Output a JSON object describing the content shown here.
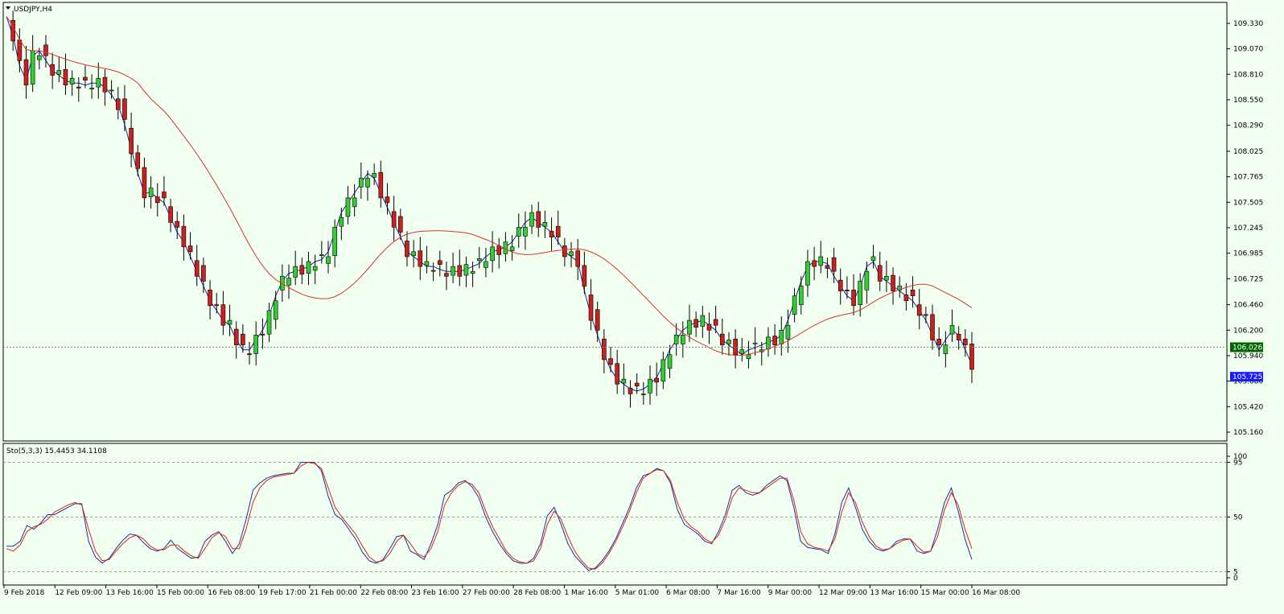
{
  "symbol_label": "USDJPY,H4",
  "indicator_label": "Sto(5,3,3) 15.4453 34.1108",
  "colors": {
    "background": "#f0fff0",
    "bull": "#32cd32",
    "bear": "#cc2020",
    "wick": "#000000",
    "ma_fast": "#2020a0",
    "ma_slow": "#e03030",
    "k_line": "#2030a0",
    "d_line": "#e02020",
    "bid_tag": "#006400",
    "ask_tag": "#1a1aff"
  },
  "chart_data": [
    {
      "type": "candlestick",
      "title": "USDJPY,H4",
      "ylim": [
        105.16,
        109.46
      ],
      "y_ticks": [
        "109.330",
        "109.070",
        "108.810",
        "108.550",
        "108.290",
        "108.025",
        "107.765",
        "107.505",
        "107.245",
        "106.985",
        "106.725",
        "106.460",
        "106.200",
        "105.940",
        "105.680",
        "105.420",
        "105.160"
      ],
      "price_tags": [
        {
          "label": "106.026",
          "value": 106.026,
          "kind": "bid"
        },
        {
          "label": "105.725",
          "value": 105.725,
          "kind": "ask"
        }
      ],
      "x_labels": [
        "9 Feb 2018",
        "12 Feb 09:00",
        "13 Feb 16:00",
        "15 Feb 00:00",
        "16 Feb 08:00",
        "19 Feb 17:00",
        "21 Feb 00:00",
        "22 Feb 08:00",
        "23 Feb 16:00",
        "27 Feb 00:00",
        "28 Feb 08:00",
        "1 Mar 16:00",
        "5 Mar 01:00",
        "6 Mar 08:00",
        "7 Mar 16:00",
        "9 Mar 00:00",
        "12 Mar 09:00",
        "13 Mar 16:00",
        "15 Mar 00:00",
        "16 Mar 08:00"
      ],
      "series_ma_fast": [
        109.4,
        109.2,
        108.9,
        108.75,
        109.0,
        109.05,
        108.95,
        108.85,
        108.8,
        108.75,
        108.72,
        108.72,
        108.7,
        108.72,
        108.72,
        108.68,
        108.6,
        108.5,
        108.3,
        108.05,
        107.8,
        107.6,
        107.6,
        107.55,
        107.5,
        107.35,
        107.2,
        107.1,
        106.95,
        106.8,
        106.65,
        106.5,
        106.4,
        106.3,
        106.25,
        106.1,
        106.0,
        106.0,
        106.1,
        106.2,
        106.35,
        106.55,
        106.7,
        106.78,
        106.8,
        106.82,
        106.85,
        106.9,
        106.92,
        107.0,
        107.2,
        107.4,
        107.5,
        107.6,
        107.7,
        107.8,
        107.75,
        107.6,
        107.45,
        107.3,
        107.15,
        107.0,
        106.95,
        106.9,
        106.85,
        106.85,
        106.82,
        106.8,
        106.8,
        106.8,
        106.82,
        106.85,
        106.88,
        106.95,
        107.0,
        107.02,
        107.05,
        107.1,
        107.2,
        107.3,
        107.35,
        107.3,
        107.25,
        107.2,
        107.1,
        107.0,
        106.95,
        106.9,
        106.6,
        106.35,
        106.15,
        105.95,
        105.8,
        105.7,
        105.65,
        105.6,
        105.58,
        105.6,
        105.65,
        105.72,
        105.85,
        106.0,
        106.1,
        106.2,
        106.25,
        106.28,
        106.3,
        106.25,
        106.2,
        106.1,
        106.05,
        106.0,
        105.95,
        106.0,
        106.02,
        106.05,
        106.08,
        106.1,
        106.15,
        106.3,
        106.5,
        106.7,
        106.85,
        106.9,
        106.9,
        106.88,
        106.75,
        106.65,
        106.55,
        106.5,
        106.65,
        106.85,
        106.9,
        106.75,
        106.7,
        106.65,
        106.6,
        106.55,
        106.5,
        106.4,
        106.3,
        106.15,
        106.0,
        106.1,
        106.2,
        106.15,
        106.0,
        105.85
      ]
    },
    {
      "type": "line",
      "title": "Sto(5,3,3) 15.4453 34.1108",
      "ylim": [
        0,
        100
      ],
      "y_ticks": [
        "100",
        "95",
        "50",
        "5",
        "0"
      ],
      "levels": [
        95,
        50,
        5
      ],
      "series": [
        {
          "name": "15.4453",
          "values": [
            26,
            26,
            30,
            43,
            40,
            45,
            52,
            52,
            55,
            58,
            61,
            61,
            30,
            17,
            12,
            16,
            24,
            31,
            36,
            35,
            29,
            24,
            22,
            24,
            31,
            24,
            20,
            16,
            17,
            30,
            35,
            38,
            30,
            20,
            28,
            48,
            72,
            78,
            82,
            84,
            85,
            86,
            86,
            95,
            95,
            95,
            88,
            67,
            52,
            48,
            40,
            32,
            21,
            14,
            12,
            15,
            24,
            34,
            35,
            22,
            19,
            15,
            28,
            44,
            68,
            72,
            78,
            80,
            75,
            66,
            50,
            38,
            28,
            20,
            14,
            12,
            12,
            16,
            28,
            51,
            58,
            44,
            28,
            18,
            12,
            6,
            8,
            14,
            22,
            32,
            45,
            58,
            74,
            84,
            86,
            90,
            88,
            78,
            56,
            44,
            40,
            36,
            30,
            28,
            38,
            52,
            72,
            76,
            70,
            68,
            70,
            76,
            80,
            84,
            80,
            58,
            30,
            25,
            24,
            23,
            20,
            36,
            62,
            74,
            58,
            40,
            30,
            24,
            22,
            24,
            30,
            32,
            32,
            22,
            20,
            22,
            40,
            62,
            74,
            55,
            32,
            15
          ]
        },
        {
          "name": "34.1108",
          "values": [
            24,
            22,
            27,
            38,
            42,
            44,
            48,
            54,
            57,
            60,
            62,
            60,
            40,
            22,
            14,
            15,
            22,
            28,
            33,
            35,
            32,
            26,
            23,
            23,
            27,
            27,
            22,
            18,
            16,
            24,
            33,
            37,
            34,
            24,
            24,
            40,
            62,
            74,
            80,
            83,
            84,
            85,
            86,
            92,
            95,
            94,
            90,
            74,
            58,
            50,
            43,
            36,
            26,
            17,
            13,
            14,
            20,
            30,
            35,
            28,
            20,
            17,
            24,
            38,
            60,
            70,
            76,
            79,
            77,
            70,
            55,
            42,
            32,
            22,
            16,
            13,
            12,
            14,
            24,
            44,
            55,
            48,
            34,
            22,
            14,
            8,
            7,
            12,
            20,
            30,
            42,
            55,
            70,
            82,
            86,
            89,
            88,
            80,
            62,
            48,
            42,
            38,
            32,
            29,
            35,
            48,
            66,
            74,
            72,
            70,
            70,
            74,
            78,
            82,
            82,
            64,
            38,
            28,
            25,
            24,
            22,
            32,
            54,
            70,
            62,
            46,
            34,
            26,
            23,
            24,
            28,
            31,
            32,
            26,
            21,
            22,
            34,
            56,
            70,
            60,
            40,
            24
          ]
        }
      ]
    }
  ]
}
